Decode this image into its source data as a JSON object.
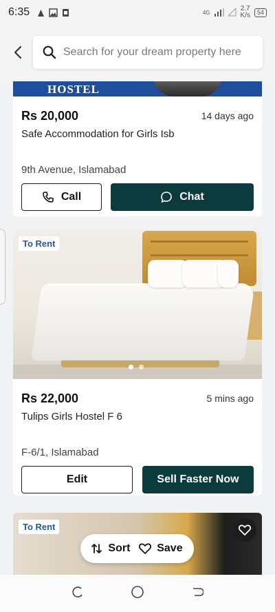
{
  "status_bar": {
    "time": "6:35",
    "network": "4G",
    "speed_value": "2.7",
    "speed_unit": "K/s",
    "battery": "54"
  },
  "search": {
    "placeholder": "Search for your dream property here"
  },
  "listings": [
    {
      "price": "Rs 20,000",
      "time_ago": "14 days ago",
      "title": "Safe Accommodation for Girls Isb",
      "location": "9th Avenue, Islamabad",
      "image_text": "HOSTEL",
      "primary_action": "Call",
      "secondary_action": "Chat"
    },
    {
      "tag": "To Rent",
      "price": "Rs 22,000",
      "time_ago": "5 mins ago",
      "title": "Tulips Girls Hostel F 6",
      "location": "F-6/1, Islamabad",
      "primary_action": "Edit",
      "secondary_action": "Sell Faster Now"
    },
    {
      "tag": "To Rent"
    }
  ],
  "floating": {
    "sort_label": "Sort",
    "save_label": "Save"
  },
  "colors": {
    "primary_dark": "#0b3b3c",
    "tag_text": "#2457a6"
  }
}
